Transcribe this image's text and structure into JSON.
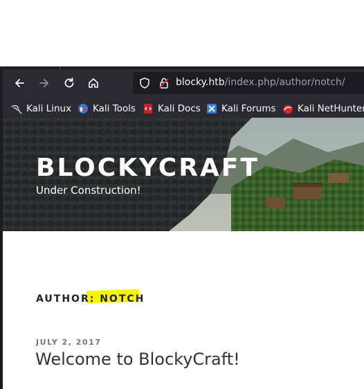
{
  "browser": {
    "url_host": "blocky.htb",
    "url_path": "/index.php/author/notch/",
    "nav": {
      "back": "arrow-left-icon",
      "forward": "arrow-right-icon",
      "reload": "reload-icon",
      "home": "home-icon"
    }
  },
  "bookmarks": [
    {
      "label": "Kali Linux",
      "icon": "kali-dragon-icon"
    },
    {
      "label": "Kali Tools",
      "icon": "kali-tools-icon"
    },
    {
      "label": "Kali Docs",
      "icon": "kali-docs-icon"
    },
    {
      "label": "Kali Forums",
      "icon": "kali-forums-icon"
    },
    {
      "label": "Kali NetHunter",
      "icon": "kali-nethunter-icon"
    }
  ],
  "site": {
    "title": "BLOCKYCRAFT",
    "description": "Under Construction!"
  },
  "archive": {
    "heading_prefix": "AUTHOR:",
    "heading_name": "NOTCH"
  },
  "post": {
    "date": "JULY 2, 2017",
    "title": "Welcome to BlockyCraft!"
  },
  "colors": {
    "toolbar": "#2b2a33",
    "urlbar": "#1c1b22",
    "highlight": "#f5f500",
    "text": "#222222"
  }
}
